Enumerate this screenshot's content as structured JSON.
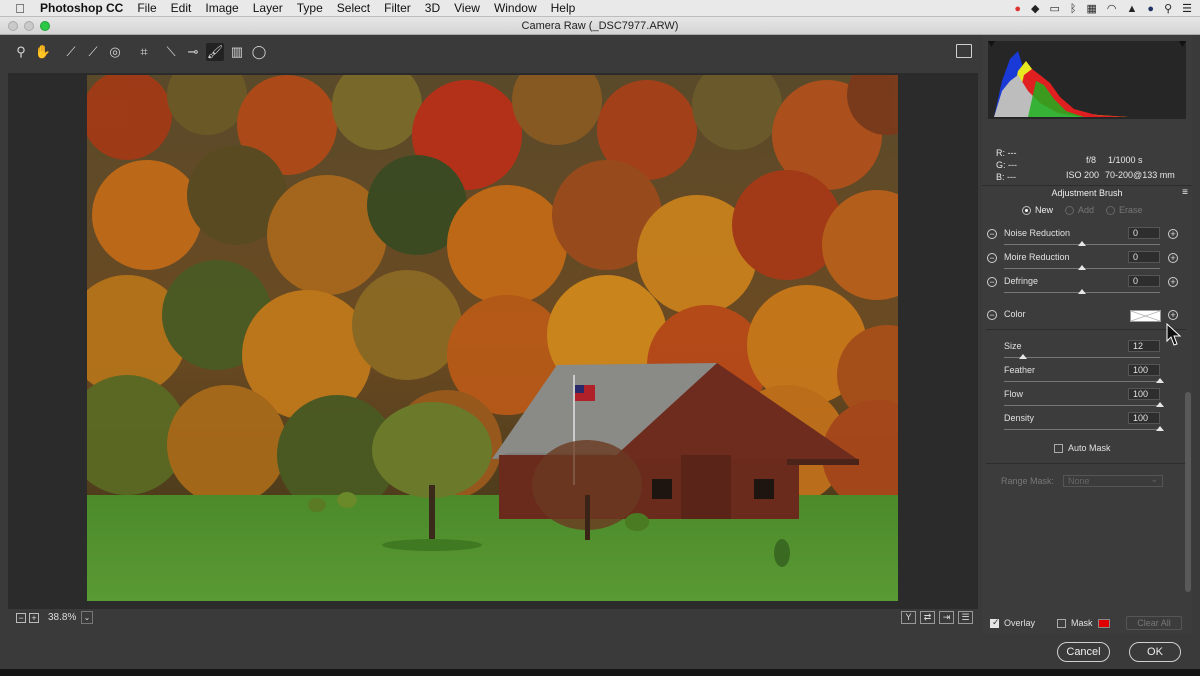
{
  "menubar": {
    "apple": "",
    "app": "Photoshop CC",
    "items": [
      "File",
      "Edit",
      "Image",
      "Layer",
      "Type",
      "Select",
      "Filter",
      "3D",
      "View",
      "Window",
      "Help"
    ]
  },
  "window": {
    "title": "Camera Raw (_DSC7977.ARW)"
  },
  "toolbar": {
    "tools": [
      "zoom-tool",
      "hand-tool",
      "white-balance-tool",
      "color-sampler-tool",
      "targeted-adjustment-tool",
      "crop-tool",
      "straighten-tool",
      "spot-removal-tool",
      "red-eye-tool",
      "adjustment-brush-tool",
      "graduated-filter-tool",
      "radial-filter-tool"
    ]
  },
  "canvas": {
    "zoom": "38.8%"
  },
  "readout": {
    "r": "R: ---",
    "g": "G: ---",
    "b": "B: ---",
    "aperture": "f/8",
    "shutter": "1/1000 s",
    "iso": "ISO 200",
    "lens": "70-200@133 mm"
  },
  "panel": {
    "title": "Adjustment Brush",
    "modes": [
      "New",
      "Add",
      "Erase"
    ],
    "sliders": [
      {
        "label": "Noise Reduction",
        "value": "0",
        "position": 0.5
      },
      {
        "label": "Moire Reduction",
        "value": "0",
        "position": 0.5
      },
      {
        "label": "Defringe",
        "value": "0",
        "position": 0.5
      }
    ],
    "color_label": "Color",
    "brush": [
      {
        "label": "Size",
        "value": "12",
        "position": 0.12
      },
      {
        "label": "Feather",
        "value": "100",
        "position": 1.0
      },
      {
        "label": "Flow",
        "value": "100",
        "position": 1.0
      },
      {
        "label": "Density",
        "value": "100",
        "position": 1.0
      }
    ],
    "auto_mask": "Auto Mask",
    "range_mask_label": "Range Mask:",
    "range_mask_value": "None",
    "overlay": "Overlay",
    "mask": "Mask",
    "mask_color": "#e00000",
    "clear_all": "Clear All"
  },
  "footer": {
    "cancel": "Cancel",
    "ok": "OK"
  }
}
